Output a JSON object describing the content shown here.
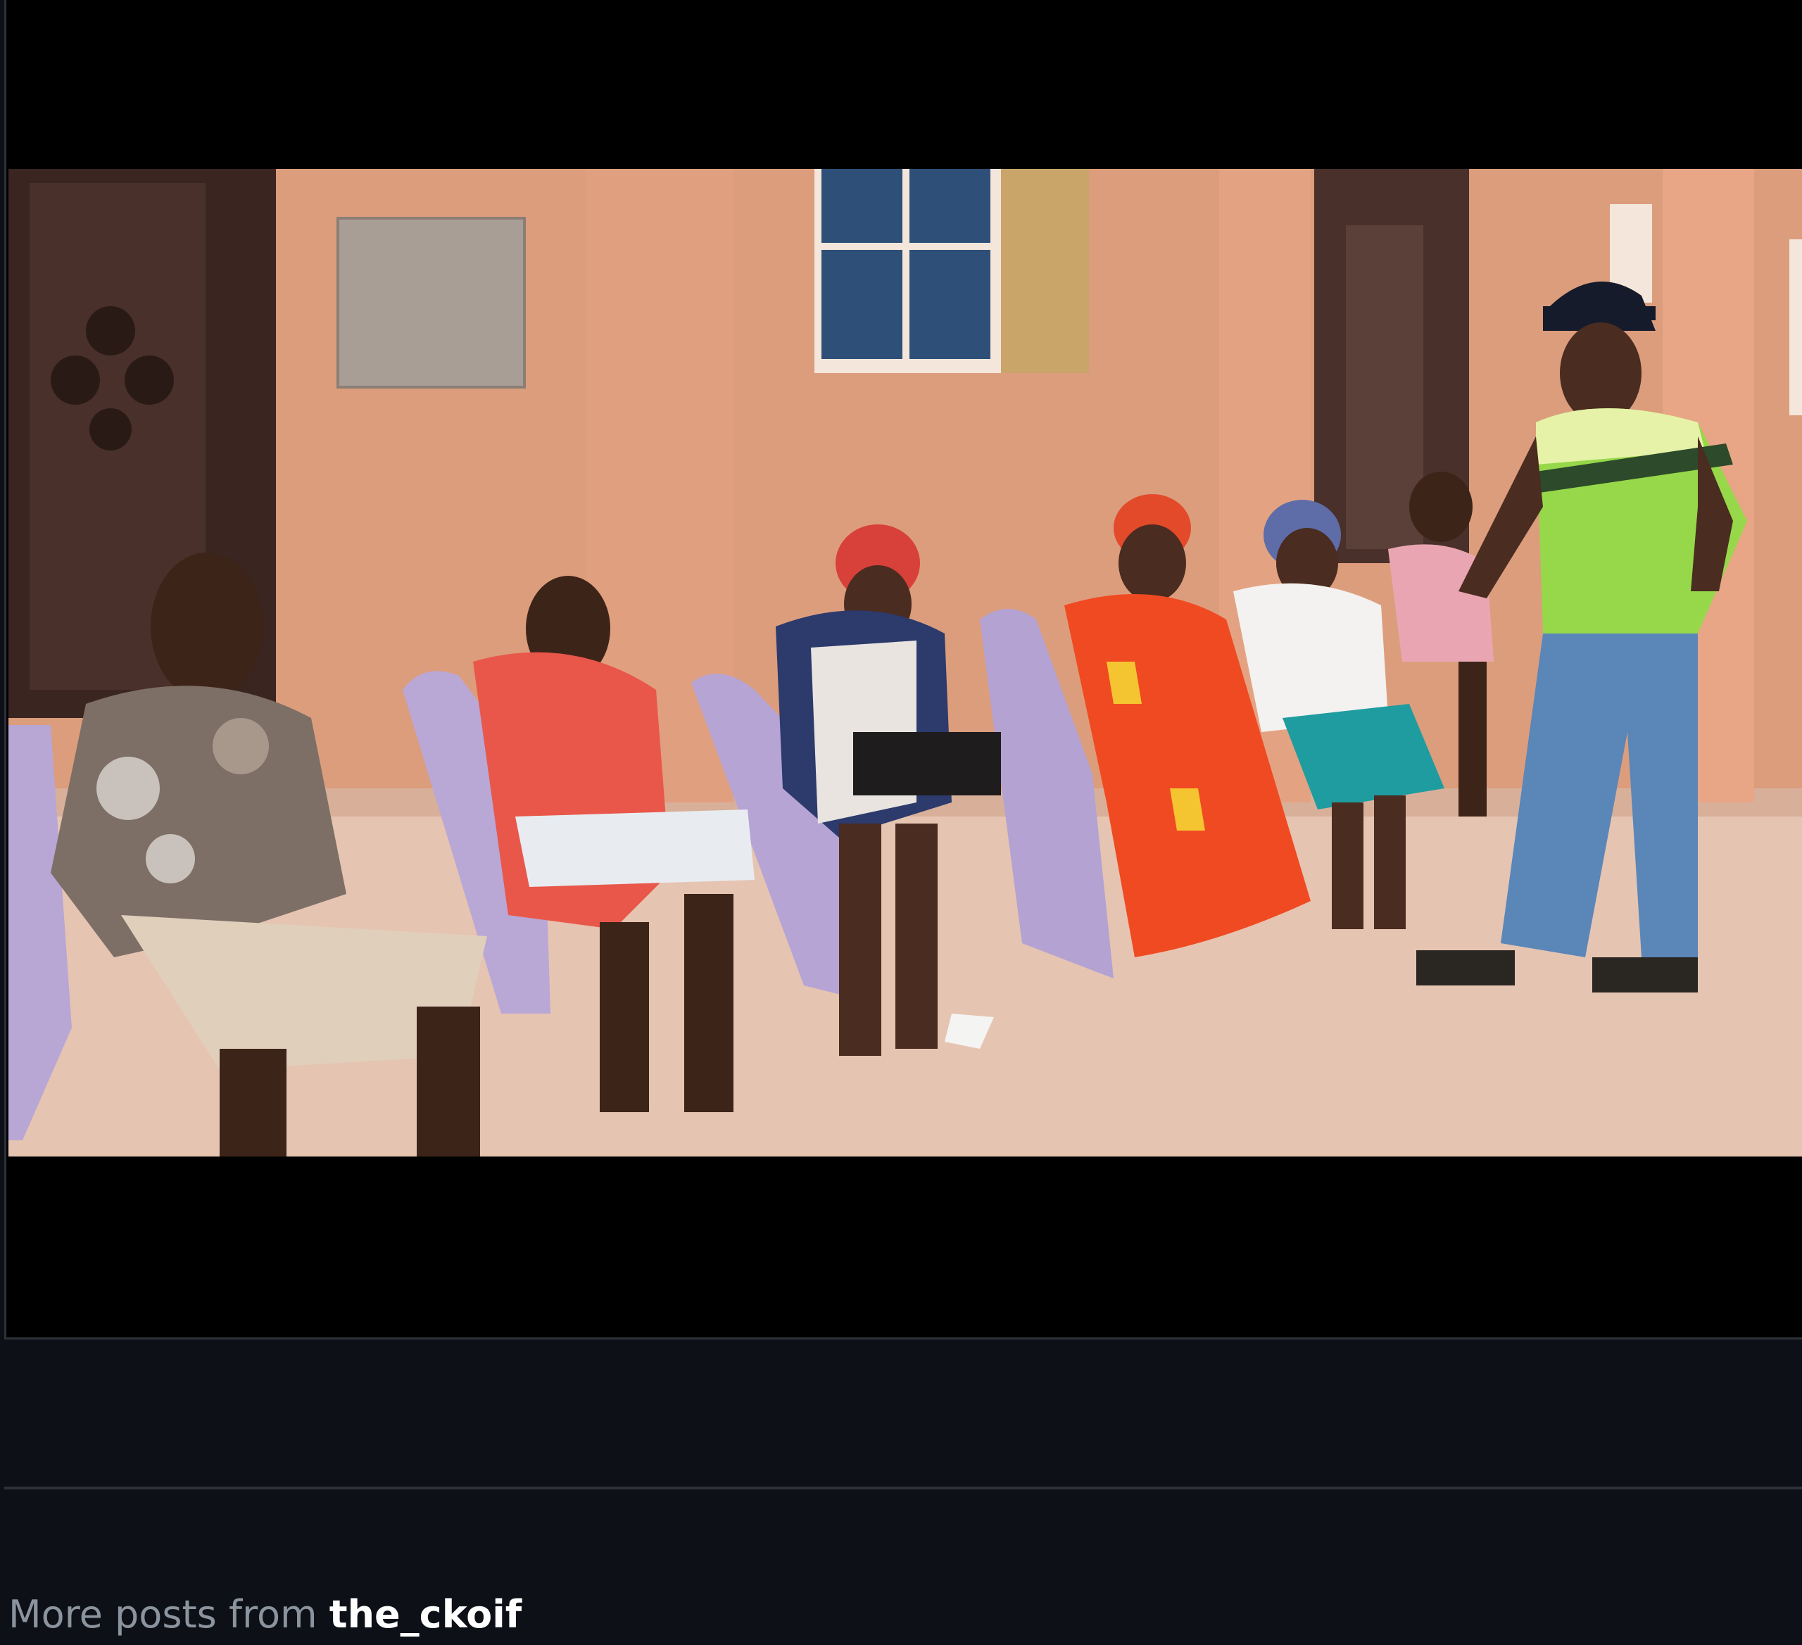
{
  "video": {
    "mute_icon": "speaker-muted-icon",
    "muted": true
  },
  "footer": {
    "more_posts_prefix": "More posts from ",
    "username": "the_ckoif"
  }
}
